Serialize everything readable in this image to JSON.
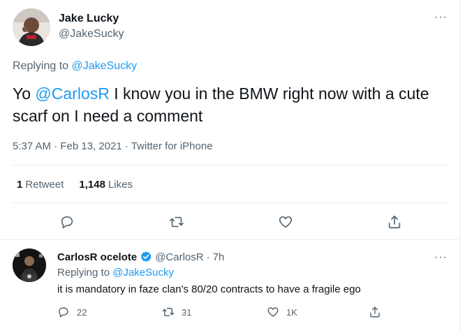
{
  "main_tweet": {
    "author_name": "Jake Lucky",
    "author_handle": "@JakeSucky",
    "more": "···",
    "replying_prefix": "Replying to ",
    "replying_handle": "@JakeSucky",
    "text_before": "Yo ",
    "mention": "@CarlosR",
    "text_after": " I know you in the BMW right now with a cute scarf on I need a comment",
    "timestamp": "5:37 AM · Feb 13, 2021 · Twitter for iPhone",
    "retweet_count": "1",
    "retweet_label": "Retweet",
    "like_count": "1,148",
    "like_label": "Likes"
  },
  "reply_tweet": {
    "author_name": "CarlosR ocelote",
    "author_handle": "@CarlosR",
    "dot": "·",
    "time": "7h",
    "more": "···",
    "replying_prefix": "Replying to ",
    "replying_handle": "@JakeSucky",
    "text": "it is mandatory in faze clan's 80/20 contracts to have a fragile ego",
    "reply_count": "22",
    "retweet_count": "31",
    "like_count": "1K"
  },
  "icons": {
    "reply": "reply-icon",
    "retweet": "retweet-icon",
    "like": "heart-icon",
    "share": "share-icon",
    "verified": "verified-badge-icon",
    "more": "more-icon"
  },
  "colors": {
    "accent": "#1d9bf0",
    "secondary_text": "#536471",
    "primary_text": "#0f1419",
    "divider": "#e6ecf0"
  }
}
